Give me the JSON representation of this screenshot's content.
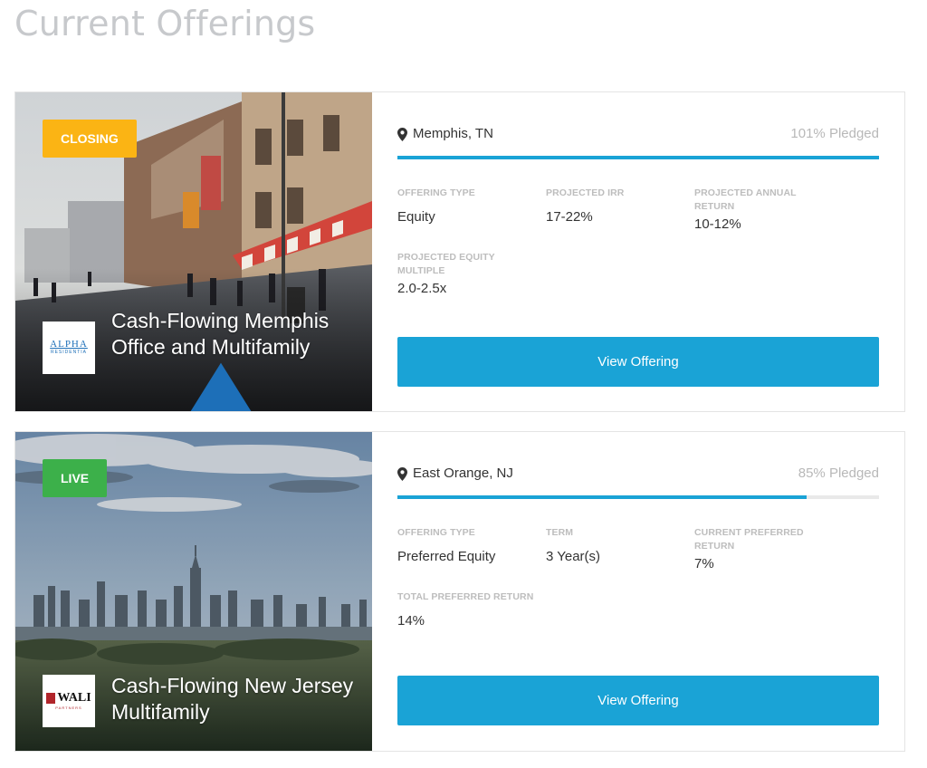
{
  "page": {
    "title": "Current Offerings"
  },
  "colors": {
    "accent": "#1aa3d6",
    "closing": "#fbb414",
    "live": "#3cb04a"
  },
  "offerings": [
    {
      "status": "CLOSING",
      "name": "Cash-Flowing Memphis Office and Multifamily",
      "sponsor_logo": {
        "text": "ALPHA",
        "subtext": "RESIDENTIA"
      },
      "location": "Memphis, TN",
      "pledged_label": "101% Pledged",
      "pledged_fraction": 1.0,
      "stats": [
        {
          "label": "OFFERING TYPE",
          "value": "Equity"
        },
        {
          "label": "PROJECTED IRR",
          "value": "17-22%"
        },
        {
          "label": "PROJECTED ANNUAL RETURN",
          "value": "10-12%"
        },
        {
          "label": "PROJECTED EQUITY MULTIPLE",
          "value": "2.0-2.5x"
        }
      ],
      "button_label": "View Offering"
    },
    {
      "status": "LIVE",
      "name": "Cash-Flowing New Jersey Multifamily",
      "sponsor_logo": {
        "text": "WALI",
        "subtext": "PARTNERS"
      },
      "location": "East Orange, NJ",
      "pledged_label": "85% Pledged",
      "pledged_fraction": 0.85,
      "stats": [
        {
          "label": "OFFERING TYPE",
          "value": "Preferred Equity"
        },
        {
          "label": "TERM",
          "value": "3 Year(s)"
        },
        {
          "label": "CURRENT PREFERRED RETURN",
          "value": "7%"
        },
        {
          "label": "TOTAL PREFERRED RETURN",
          "value": "14%"
        }
      ],
      "button_label": "View Offering"
    }
  ]
}
